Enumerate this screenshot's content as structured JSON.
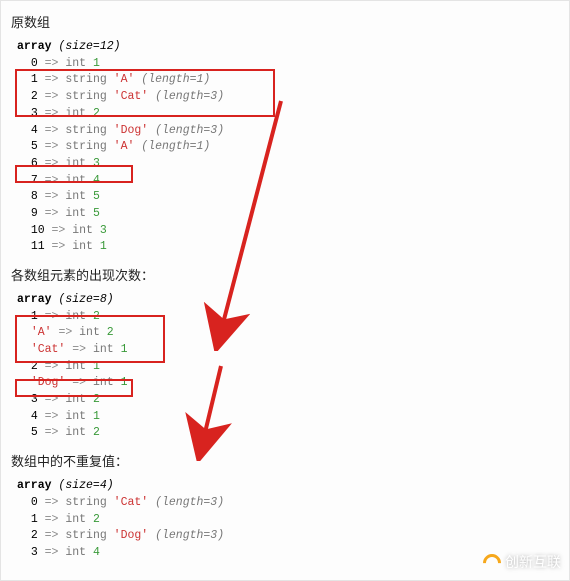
{
  "sections": {
    "original": {
      "title": "原数组",
      "size_label": "(size=12)"
    },
    "counts": {
      "title": "各数组元素的出现次数：",
      "size_label": "(size=8)"
    },
    "unique": {
      "title": "数组中的不重复值：",
      "size_label": "(size=4)"
    }
  },
  "array_keyword": "array",
  "arrays": {
    "original": [
      {
        "key": "0",
        "type": "int",
        "int": "1"
      },
      {
        "key": "1",
        "type": "string",
        "str": "'A'",
        "len": "(length=1)"
      },
      {
        "key": "2",
        "type": "string",
        "str": "'Cat'",
        "len": "(length=3)"
      },
      {
        "key": "3",
        "type": "int",
        "int": "2"
      },
      {
        "key": "4",
        "type": "string",
        "str": "'Dog'",
        "len": "(length=3)"
      },
      {
        "key": "5",
        "type": "string",
        "str": "'A'",
        "len": "(length=1)"
      },
      {
        "key": "6",
        "type": "int",
        "int": "3"
      },
      {
        "key": "7",
        "type": "int",
        "int": "4"
      },
      {
        "key": "8",
        "type": "int",
        "int": "5"
      },
      {
        "key": "9",
        "type": "int",
        "int": "5"
      },
      {
        "key": "10",
        "type": "int",
        "int": "3"
      },
      {
        "key": "11",
        "type": "int",
        "int": "1"
      }
    ],
    "counts": [
      {
        "key": "1",
        "type": "int",
        "int": "2"
      },
      {
        "key": "'A'",
        "type": "int",
        "int": "2"
      },
      {
        "key": "'Cat'",
        "type": "int",
        "int": "1"
      },
      {
        "key": "2",
        "type": "int",
        "int": "1"
      },
      {
        "key": "'Dog'",
        "type": "int",
        "int": "1"
      },
      {
        "key": "3",
        "type": "int",
        "int": "2"
      },
      {
        "key": "4",
        "type": "int",
        "int": "1"
      },
      {
        "key": "5",
        "type": "int",
        "int": "2"
      }
    ],
    "unique": [
      {
        "key": "0",
        "type": "string",
        "str": "'Cat'",
        "len": "(length=3)"
      },
      {
        "key": "1",
        "type": "int",
        "int": "2"
      },
      {
        "key": "2",
        "type": "string",
        "str": "'Dog'",
        "len": "(length=3)"
      },
      {
        "key": "3",
        "type": "int",
        "int": "4"
      }
    ]
  },
  "logo_text": "创新互联"
}
